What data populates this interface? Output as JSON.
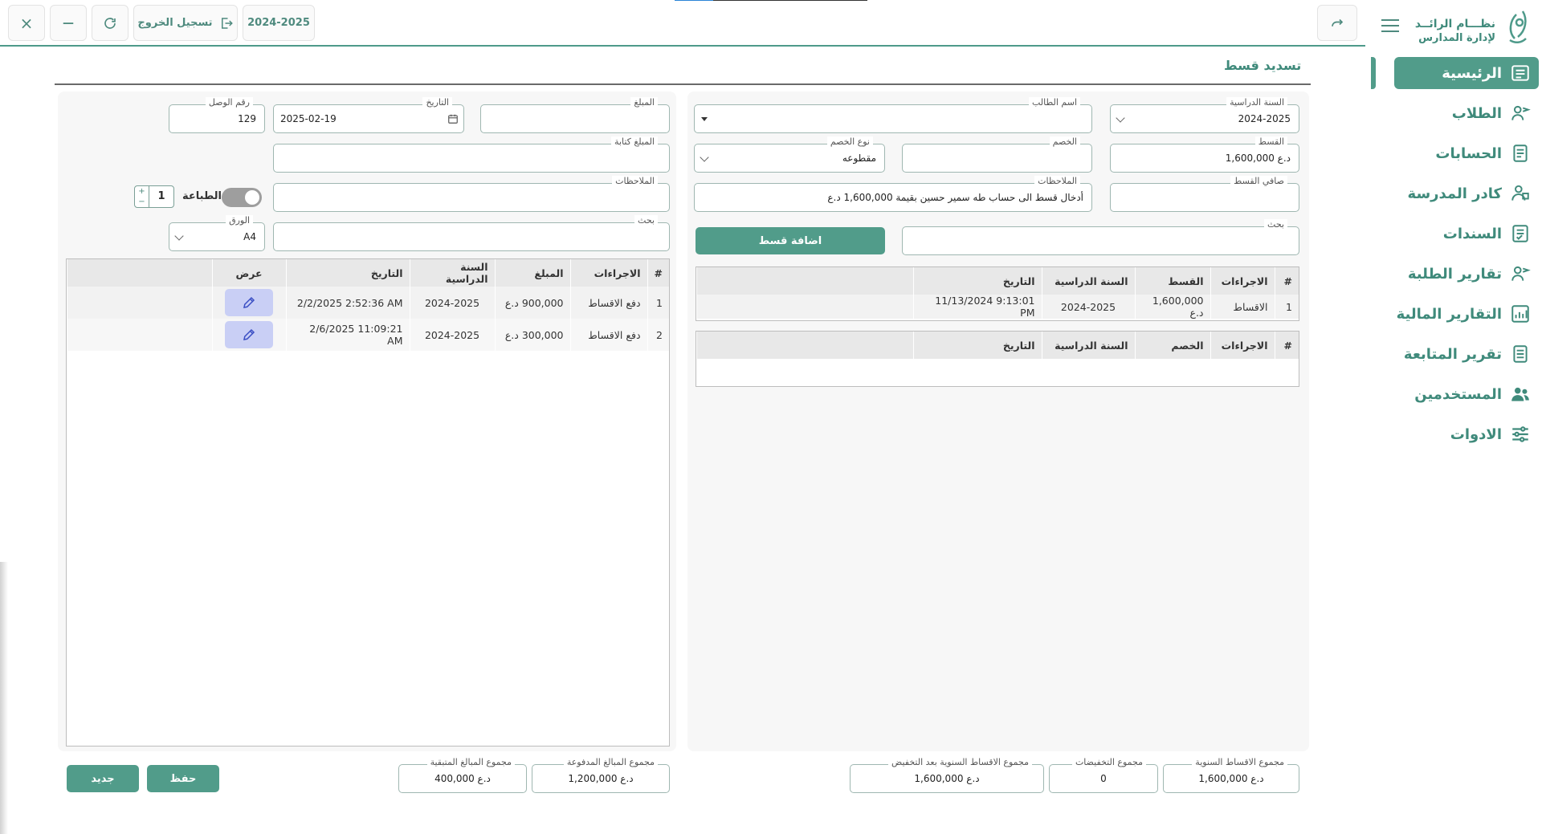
{
  "topbar": {
    "close_icon": "×",
    "minimize_icon": "—",
    "logout_label": "تسجيل الخروج",
    "year_badge": "2024-2025"
  },
  "page": {
    "title": "تسديد قسط"
  },
  "right_panel": {
    "school_year": {
      "label": "السنة الدراسية",
      "value": "2024-2025"
    },
    "student_name": {
      "label": "اسم الطالب",
      "value": ""
    },
    "installment": {
      "label": "القسط",
      "value": "1,600,000 د.ع"
    },
    "discount": {
      "label": "الخصم",
      "value": ""
    },
    "discount_type": {
      "label": "نوع الخصم",
      "value": "مقطوعه"
    },
    "net_installment": {
      "label": "صافي القسط",
      "value": ""
    },
    "notes": {
      "label": "الملاحظات",
      "value": "أدخال قسط الى حساب  طه سمير حسين   بقيمة 1,600,000 د.ع"
    },
    "search": {
      "label": "بحث",
      "value": ""
    },
    "add_button": "اضافة قسط",
    "installments_table": {
      "headers": [
        "#",
        "الاجراءات",
        "القسط",
        "السنة الدراسية",
        "التاريخ"
      ],
      "rows": [
        [
          "1",
          "الاقساط",
          "1,600,000 د.ع",
          "2024-2025",
          "11/13/2024 9:13:01 PM"
        ]
      ]
    },
    "discounts_table": {
      "headers": [
        "#",
        "الاجراءات",
        "الخصم",
        "السنة الدراسية",
        "التاريخ"
      ],
      "rows": []
    }
  },
  "left_panel": {
    "amount": {
      "label": "المبلغ",
      "value": ""
    },
    "date": {
      "label": "التاريخ",
      "value": "2025-02-19"
    },
    "receipt_no": {
      "label": "رقم الوصل",
      "value": "129"
    },
    "amount_words": {
      "label": "المبلغ كتابة",
      "value": ""
    },
    "notes": {
      "label": "الملاحظات",
      "value": ""
    },
    "print": {
      "label": "الطباعة",
      "copies": "1",
      "plus": "+",
      "minus": "−"
    },
    "search": {
      "label": "بحث",
      "value": ""
    },
    "paper": {
      "label": "الورق",
      "value": "A4"
    },
    "payments_table": {
      "headers": [
        "#",
        "الاجراءات",
        "المبلغ",
        "السنة الدراسية",
        "التاريخ",
        "عرض"
      ],
      "rows": [
        [
          "1",
          "دفع الاقساط",
          "900,000 د.ع",
          "2024-2025",
          "2/2/2025 2:52:36 AM"
        ],
        [
          "2",
          "دفع الاقساط",
          "300,000 د.ع",
          "2024-2025",
          "2/6/2025 11:09:21 AM"
        ]
      ]
    }
  },
  "totals": {
    "annual_installments": {
      "label": "مجموع الاقساط السنوية",
      "value": "1,600,000 د.ع"
    },
    "discounts": {
      "label": "مجموع التخفيضات",
      "value": "0"
    },
    "annual_after_discount": {
      "label": "مجموع الاقساط السنوية بعد التخفيض",
      "value": "1,600,000 د.ع"
    },
    "paid": {
      "label": "مجموع المبالغ المدفوعة",
      "value": "1,200,000 د.ع"
    },
    "remaining": {
      "label": "مجموع المبالغ المتبقية",
      "value": "400,000 د.ع"
    }
  },
  "actions": {
    "save_label": "حفظ",
    "new_label": "جديد"
  },
  "sidebar": {
    "logo_line1": "نظـــام الرائــد",
    "logo_line2": "لإدارة المدارس",
    "items": [
      {
        "label": "الرئيسية",
        "icon": "dashboard-icon"
      },
      {
        "label": "الطلاب",
        "icon": "students-icon"
      },
      {
        "label": "الحسابات",
        "icon": "accounts-icon"
      },
      {
        "label": "كادر المدرسة",
        "icon": "staff-icon"
      },
      {
        "label": "السندات",
        "icon": "vouchers-icon"
      },
      {
        "label": "تقارير الطلبة",
        "icon": "student-reports-icon"
      },
      {
        "label": "التقارير المالية",
        "icon": "financial-reports-icon"
      },
      {
        "label": "تقرير المتابعة",
        "icon": "followup-report-icon"
      },
      {
        "label": "المستخدمين",
        "icon": "users-icon"
      },
      {
        "label": "الادوات",
        "icon": "tools-icon"
      }
    ]
  },
  "colors": {
    "accent": "#519c8a",
    "accent_text": "#3f8a7b",
    "edit_button": "#c9cff5"
  }
}
